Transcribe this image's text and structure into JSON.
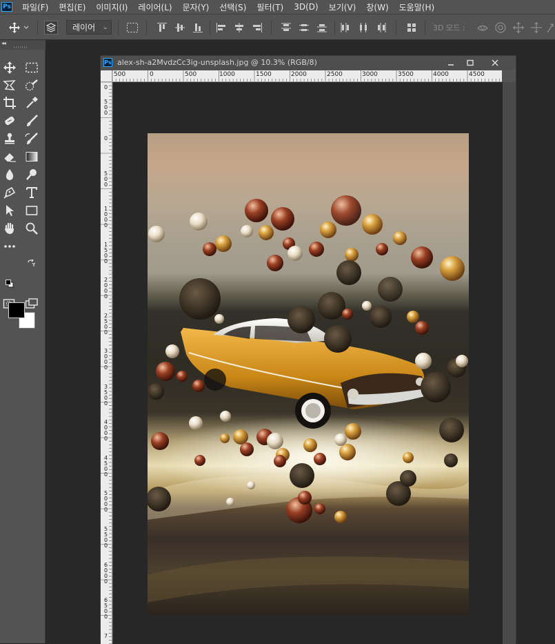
{
  "menubar": {
    "logo": "Ps",
    "items": [
      "파일(F)",
      "편집(E)",
      "이미지(I)",
      "레이어(L)",
      "문자(Y)",
      "선택(S)",
      "필터(T)",
      "3D(D)",
      "보기(V)",
      "창(W)",
      "도움말(H)"
    ]
  },
  "options": {
    "auto_select_value": "레이어",
    "mode_3d_label": "3D 모드 :"
  },
  "document": {
    "icon_label": "Ps",
    "title": "alex-sh-a2MvdzCc3ig-unsplash.jpg @ 10.3% (RGB/8)",
    "ruler_h_labels": [
      "500",
      "0",
      "500",
      "1000",
      "1500",
      "2000",
      "2500",
      "3000",
      "3500",
      "4000",
      "4500"
    ],
    "ruler_v_labels": [
      "0",
      "500",
      "0",
      "500",
      "1000",
      "1500",
      "2000",
      "2500",
      "3000",
      "3500",
      "4000",
      "4500",
      "5000",
      "5500",
      "6000",
      "6500",
      "7"
    ]
  },
  "colors": {
    "foreground": "#000000",
    "background": "#ffffff",
    "accent": "#31a8ff"
  },
  "photo": {
    "description_icon": "photo-canvas"
  }
}
